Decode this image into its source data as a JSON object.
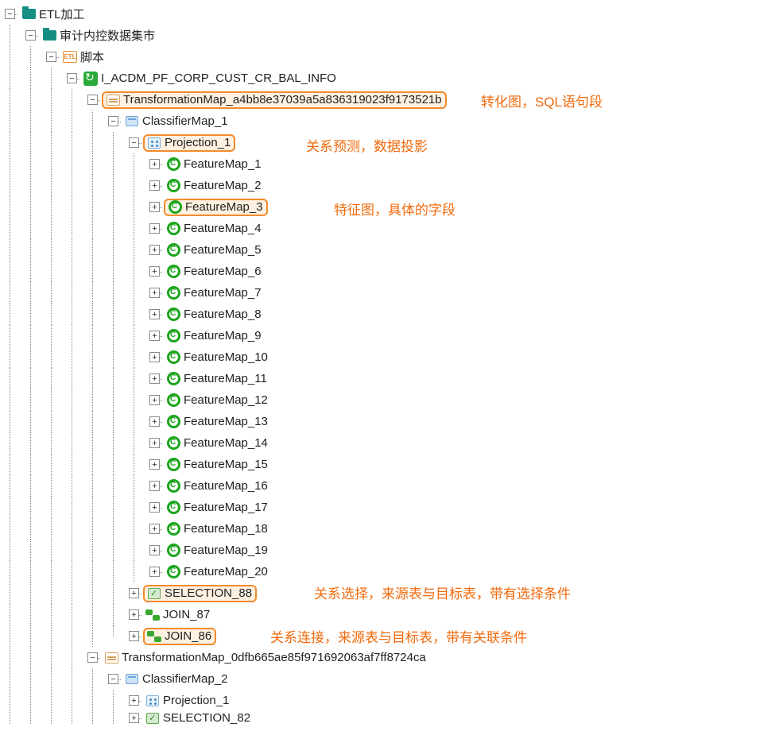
{
  "root": {
    "label": "ETL加工",
    "child": {
      "label": "审计内控数据集市",
      "script": {
        "label": "脚本",
        "job": {
          "label": "I_ACDM_PF_CORP_CUST_CR_BAL_INFO",
          "map1": {
            "label": "TransformationMap_a4bb8e37039a5a836319023f9173521b",
            "classifier": {
              "label": "ClassifierMap_1",
              "projection": {
                "label": "Projection_1"
              },
              "features": [
                "FeatureMap_1",
                "FeatureMap_2",
                "FeatureMap_3",
                "FeatureMap_4",
                "FeatureMap_5",
                "FeatureMap_6",
                "FeatureMap_7",
                "FeatureMap_8",
                "FeatureMap_9",
                "FeatureMap_10",
                "FeatureMap_11",
                "FeatureMap_12",
                "FeatureMap_13",
                "FeatureMap_14",
                "FeatureMap_15",
                "FeatureMap_16",
                "FeatureMap_17",
                "FeatureMap_18",
                "FeatureMap_19",
                "FeatureMap_20"
              ],
              "selection": "SELECTION_88",
              "join1": "JOIN_87",
              "join2": "JOIN_86"
            }
          },
          "map2": {
            "label": "TransformationMap_0dfb665ae85f971692063af7ff8724ca",
            "classifier": {
              "label": "ClassifierMap_2",
              "projection": "Projection_1",
              "selection": "SELECTION_82"
            }
          }
        }
      }
    }
  },
  "toggle": {
    "minus": "−",
    "plus": "+"
  },
  "annotations": {
    "transform": "转化图，SQL语句段",
    "projection": "关系预测，数据投影",
    "feature": "特征图，具体的字段",
    "selection": "关系选择，来源表与目标表，带有选择条件",
    "join": "关系连接，来源表与目标表，带有关联条件"
  }
}
